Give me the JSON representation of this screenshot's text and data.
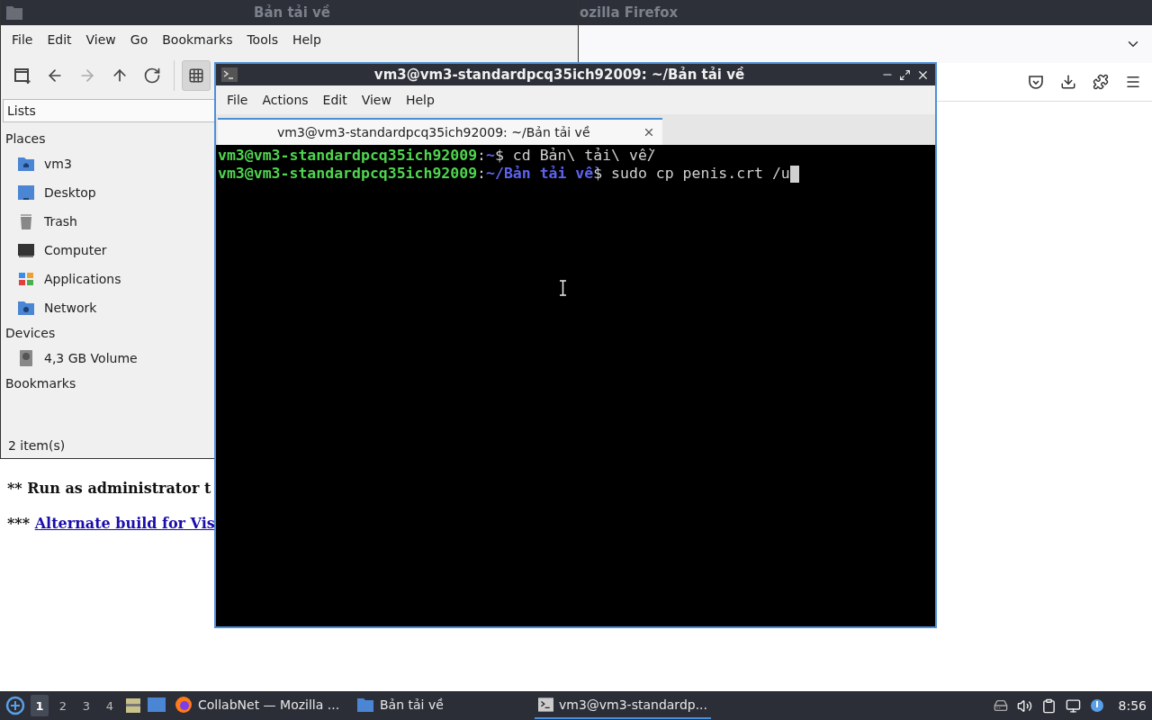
{
  "firefox": {
    "title": "ozilla Firefox",
    "page_lines": [
      {
        "prefix": "** ",
        "text": "Run as administrator t",
        "kind": "bold"
      },
      {
        "prefix": "*** ",
        "text": "Alternate build for Vis",
        "kind": "link"
      }
    ]
  },
  "file_manager": {
    "title": "Bản tải về",
    "menu": [
      "File",
      "Edit",
      "View",
      "Go",
      "Bookmarks",
      "Tools",
      "Help"
    ],
    "toolbar": [
      {
        "disabled": false,
        "selected": false
      },
      {
        "disabled": false,
        "selected": false
      },
      {
        "disabled": true,
        "selected": false
      },
      {
        "disabled": false,
        "selected": false
      },
      {
        "disabled": false,
        "selected": false
      },
      {
        "disabled": false,
        "selected": true
      }
    ],
    "side_pane_mode": "Lists",
    "sections": [
      {
        "title": "Places",
        "items": [
          {
            "label": "vm3"
          },
          {
            "label": "Desktop"
          },
          {
            "label": "Trash"
          },
          {
            "label": "Computer"
          },
          {
            "label": "Applications"
          },
          {
            "label": "Network"
          }
        ]
      },
      {
        "title": "Devices",
        "items": [
          {
            "label": "4,3 GB Volume"
          }
        ]
      },
      {
        "title": "Bookmarks"
      }
    ],
    "status": "2 item(s)"
  },
  "terminal": {
    "title": "vm3@vm3-standardpcq35ich92009: ~/Bản tải về",
    "menu": [
      "File",
      "Actions",
      "Edit",
      "View",
      "Help"
    ],
    "tabs": [
      {
        "label": "vm3@vm3-standardpcq35ich92009: ~/Bản tải về",
        "selected": true
      }
    ],
    "lines": [
      {
        "user": "vm3@vm3-standardpcq35ich92009",
        "sep": ":",
        "path": "~",
        "rest": "$ cd Bản\\ tải\\ về/",
        "cursor": false
      },
      {
        "user": "vm3@vm3-standardpcq35ich92009",
        "sep": ":",
        "path": "~/Bản tải về",
        "rest": "$ sudo cp penis.crt /u",
        "cursor": true
      }
    ]
  },
  "taskbar": {
    "workspaces": [
      {
        "label": "1",
        "selected": true
      },
      {
        "label": "2",
        "selected": false
      },
      {
        "label": "3",
        "selected": false
      },
      {
        "label": "4",
        "selected": false
      }
    ],
    "tasks": [
      {
        "label": "CollabNet — Mozilla ...",
        "selected": false
      },
      {
        "label": "Bản tải về",
        "selected": false
      },
      {
        "label": "vm3@vm3-standardp...",
        "selected": true
      }
    ],
    "clock": "8:56"
  }
}
